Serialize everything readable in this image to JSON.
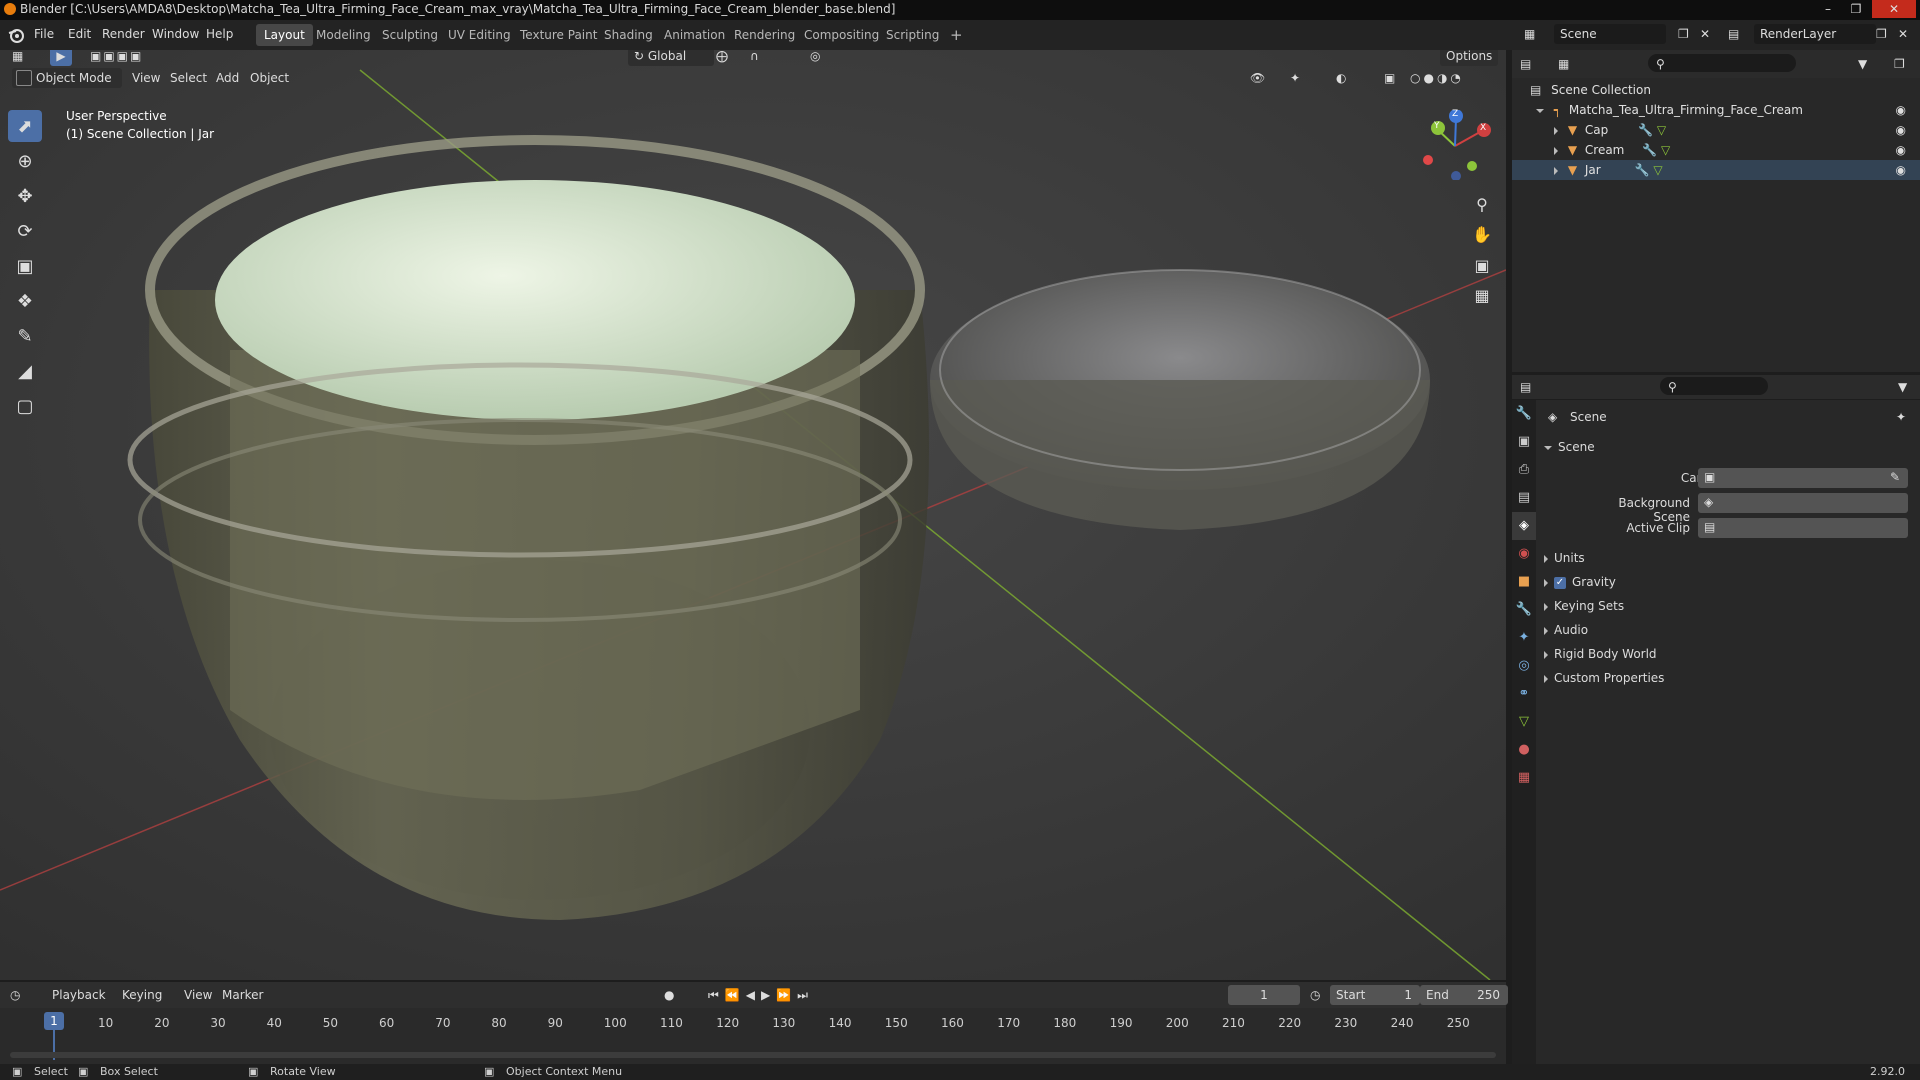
{
  "window": {
    "title": "Blender [C:\\Users\\AMDA8\\Desktop\\Matcha_Tea_Ultra_Firming_Face_Cream_max_vray\\Matcha_Tea_Ultra_Firming_Face_Cream_blender_base.blend]"
  },
  "menu": [
    "File",
    "Edit",
    "Render",
    "Window",
    "Help"
  ],
  "workspaces": [
    {
      "label": "Layout",
      "active": true
    },
    {
      "label": "Modeling"
    },
    {
      "label": "Sculpting"
    },
    {
      "label": "UV Editing"
    },
    {
      "label": "Texture Paint"
    },
    {
      "label": "Shading"
    },
    {
      "label": "Animation"
    },
    {
      "label": "Rendering"
    },
    {
      "label": "Compositing"
    },
    {
      "label": "Scripting"
    }
  ],
  "scene_field": "Scene",
  "render_layer": "RenderLayer",
  "viewport_header": {
    "transform_orientation": "Global",
    "options": "Options",
    "mode": "Object Mode",
    "menus": [
      "View",
      "Select",
      "Add",
      "Object"
    ]
  },
  "viewport": {
    "perspective": "User Perspective",
    "collection": "(1) Scene Collection | Jar"
  },
  "gizmo_axes": [
    "X",
    "Y",
    "Z"
  ],
  "outliner": {
    "root": "Scene Collection",
    "collection": "Matcha_Tea_Ultra_Firming_Face_Cream",
    "objects": [
      "Cap",
      "Cream",
      "Jar"
    ]
  },
  "properties": {
    "context": "Scene",
    "panel": "Scene",
    "fields": [
      "Camera",
      "Background Scene",
      "Active Clip"
    ],
    "subpanels": [
      "Units",
      "Gravity",
      "Keying Sets",
      "Audio",
      "Rigid Body World",
      "Custom Properties"
    ],
    "gravity_checked": true
  },
  "timeline": {
    "menus": [
      "Playback",
      "Keying",
      "View",
      "Marker"
    ],
    "current_frame": "1",
    "start_label": "Start",
    "start": "1",
    "end_label": "End",
    "end": "250",
    "ruler": [
      "10",
      "20",
      "30",
      "40",
      "50",
      "60",
      "70",
      "80",
      "90",
      "100",
      "110",
      "120",
      "130",
      "140",
      "150",
      "160",
      "170",
      "180",
      "190",
      "200",
      "210",
      "220",
      "230",
      "240",
      "250"
    ],
    "playhead": "1"
  },
  "statusbar": {
    "select": "Select",
    "box_select": "Box Select",
    "rotate": "Rotate View",
    "context_menu": "Object Context Menu",
    "version": "2.92.0"
  },
  "colors": {
    "accent": "#4c6fa6",
    "orange": "#e87d0d",
    "x_axis": "#d04040",
    "y_axis": "#8dc43a",
    "z_axis": "#3f78d8"
  }
}
